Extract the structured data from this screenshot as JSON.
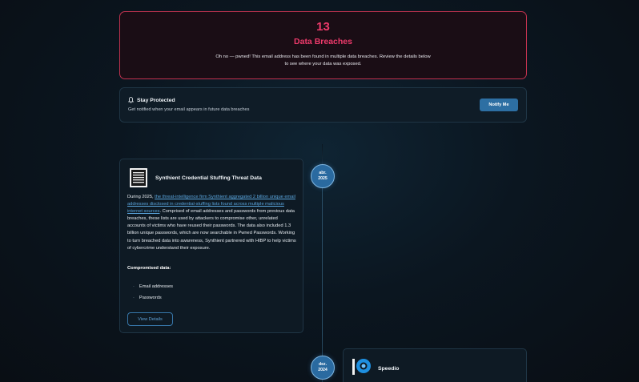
{
  "alert": {
    "count": "13",
    "label": "Data Breaches",
    "message": "Oh no — pwned! This email address has been found in multiple data breaches. Review the details below to see where your data was exposed."
  },
  "protect": {
    "title": "Stay Protected",
    "subtitle": "Get notified when your email appears in future data breaches",
    "button": "Notify Me"
  },
  "breaches": [
    {
      "date_month": "abr.",
      "date_year": "2025",
      "name": "Synthient Credential Stuffing Threat Data",
      "desc_prefix": "During 2025, ",
      "desc_link": "the threat-intelligence firm Synthient aggregated 2 billion unique email addresses disclosed in credential-stuffing lists found across multiple malicious internet sources",
      "desc_suffix": ". Comprised of email addresses and passwords from previous data breaches, these lists are used by attackers to compromise other, unrelated accounts of victims who have reused their passwords. The data also included 1.3 billion unique passwords, which are now searchable in Pwned Passwords. Working to turn breached data into awareness, Synthient partnered with HIBP to help victims of cybercrime understand their exposure.",
      "compromised_title": "Compromised data:",
      "compromised": [
        "Email addresses",
        "Passwords"
      ],
      "view_button": "View Details",
      "icon": "document-icon"
    },
    {
      "date_month": "dez.",
      "date_year": "2024",
      "name": "Speedio",
      "icon": "speedio-logo-icon"
    }
  ],
  "colors": {
    "accent_pink": "#ee3a6b",
    "accent_blue": "#2d6fa3",
    "link": "#5aa5dd"
  }
}
